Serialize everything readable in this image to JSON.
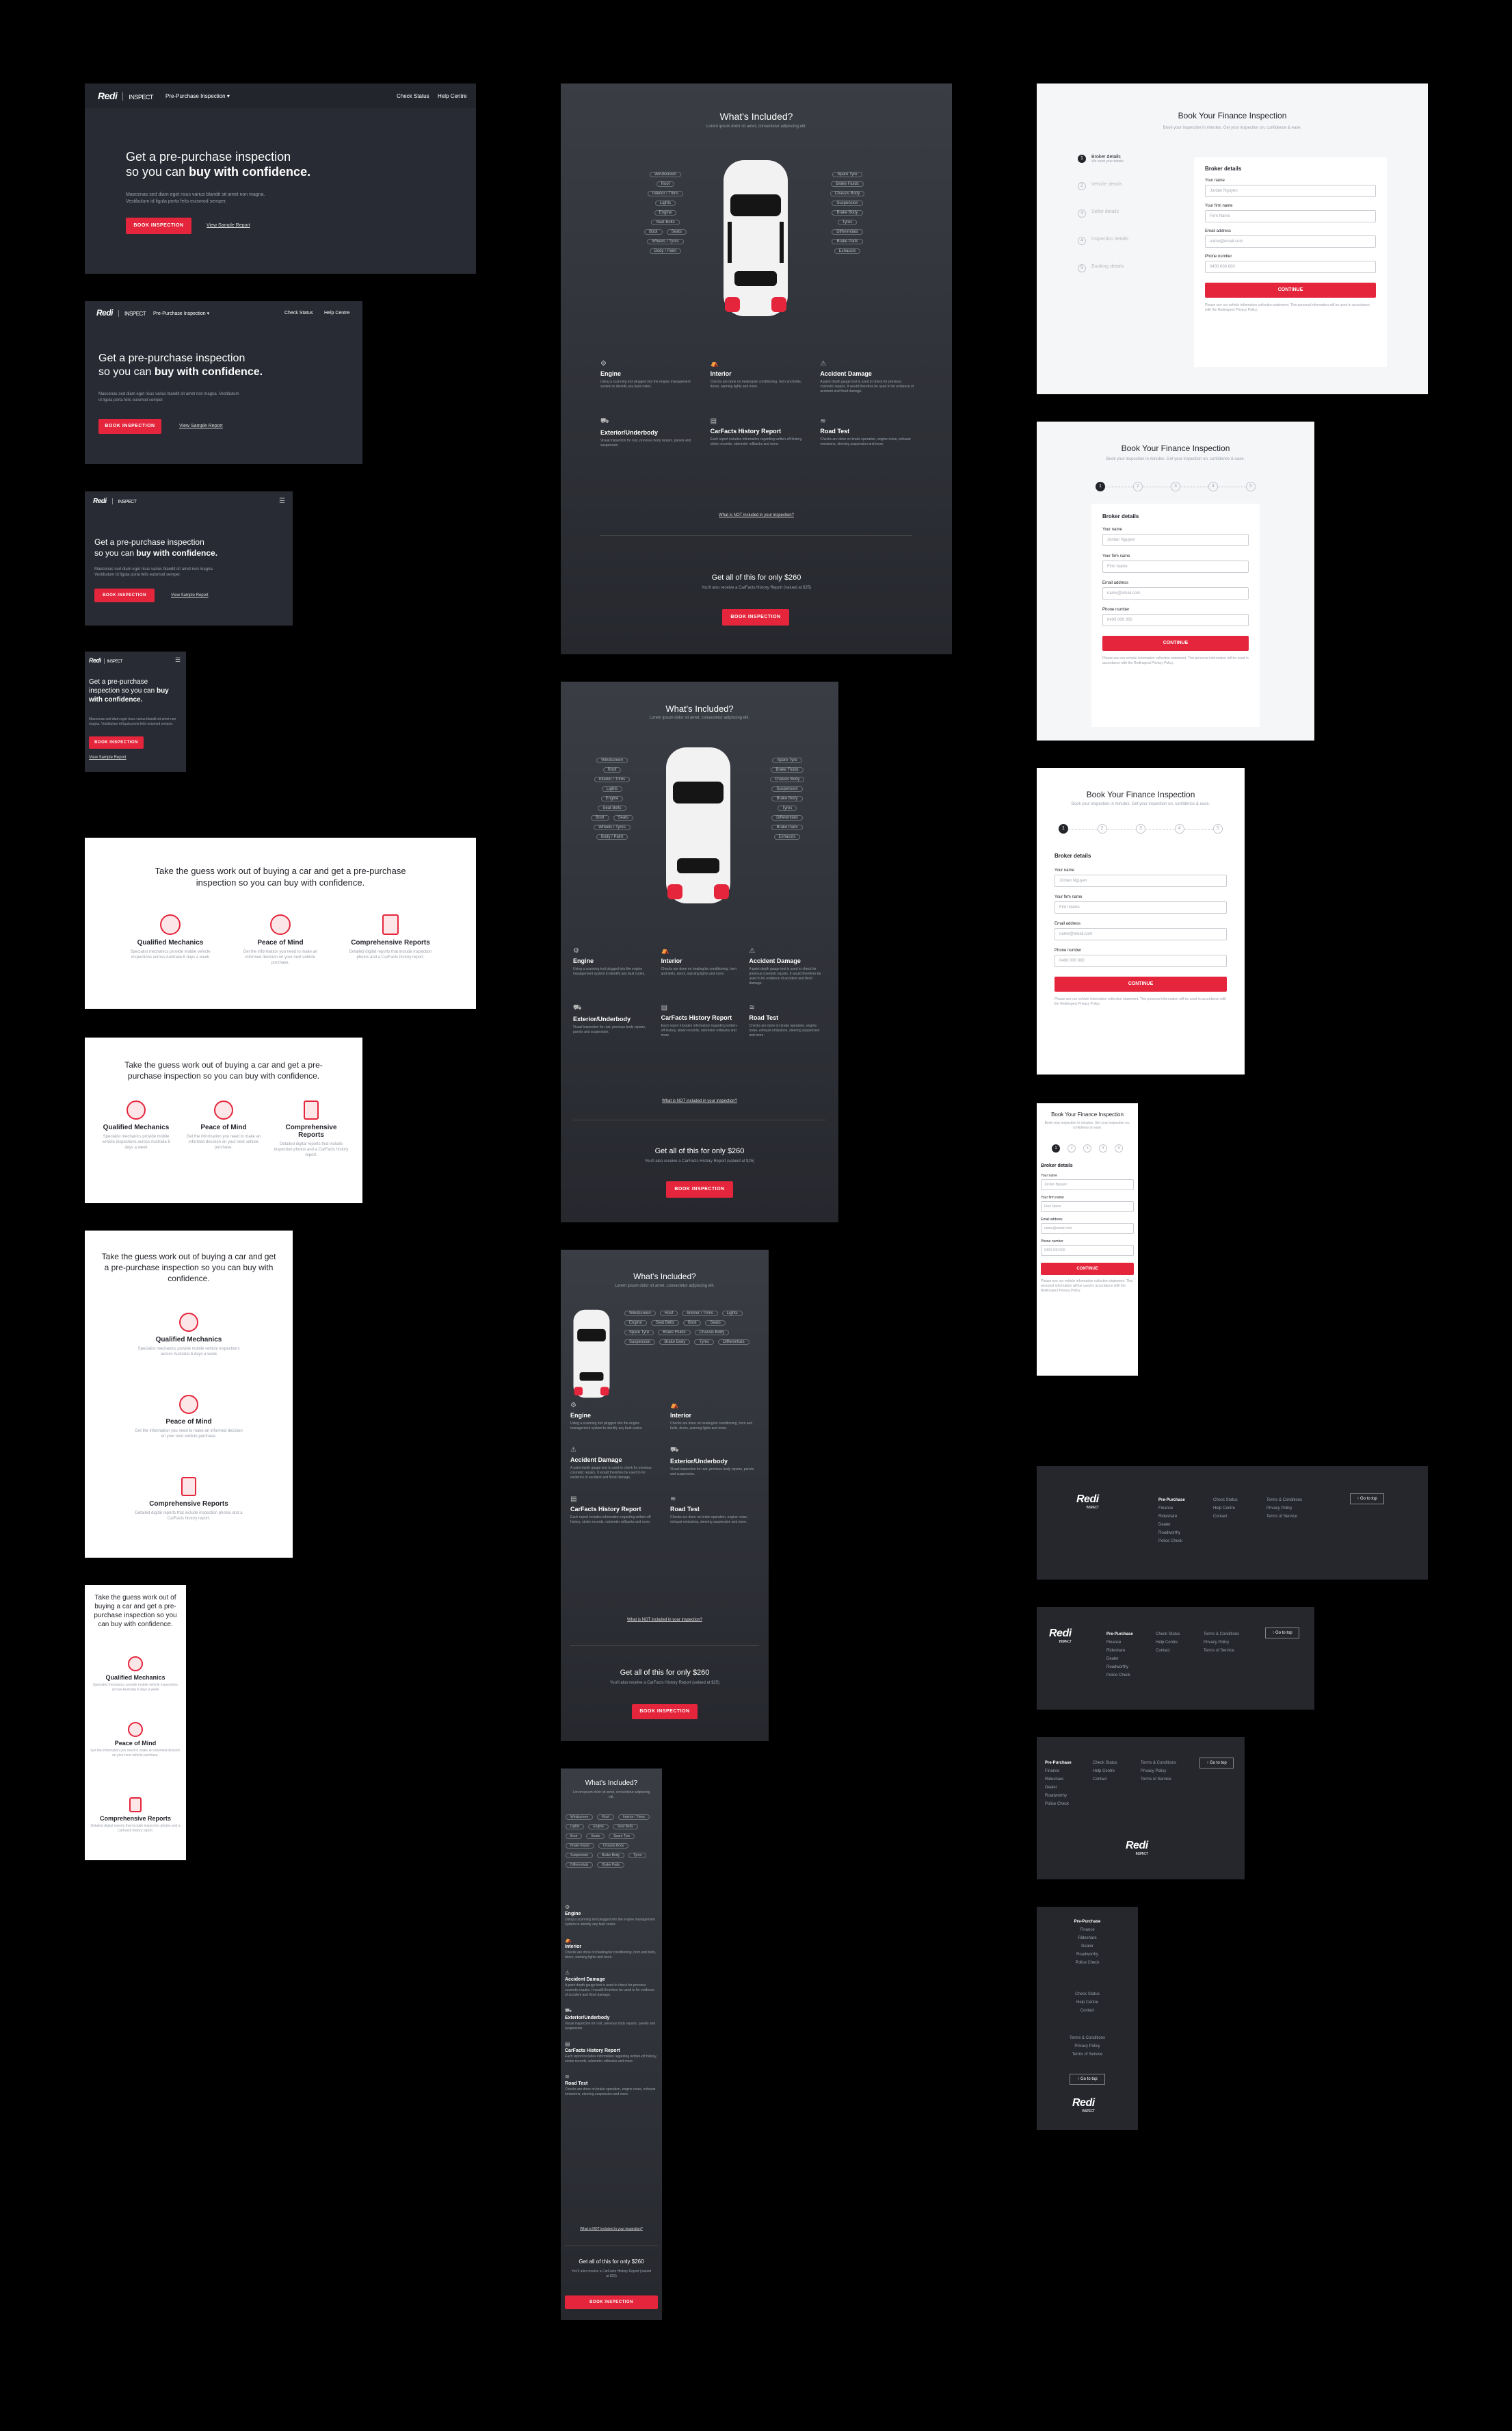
{
  "brand": {
    "logo": "Redi",
    "sub": "INSPECT"
  },
  "hero": {
    "nav_item": "Pre-Purchase Inspection",
    "nav_check": "Check Status",
    "nav_help": "Help Centre",
    "title_a": "Get a pre-purchase inspection",
    "title_b": "so you can ",
    "title_strong": "buy with confidence.",
    "body": "Maecenas sed diam eget risus varius blandit sit amet non magna. Vestibulum id ligula porta felis euismod semper.",
    "cta": "BOOK INSPECTION",
    "sample": "View Sample Report"
  },
  "benefits": {
    "heading": "Take the guess work out of buying a car and get a pre-purchase inspection so you can buy with confidence.",
    "items": [
      {
        "title": "Qualified Mechanics",
        "text": "Specialist mechanics provide mobile vehicle inspections across Australia 6 days a week"
      },
      {
        "title": "Peace of Mind",
        "text": "Get the information you need to make an informed decision on your next vehicle purchase."
      },
      {
        "title": "Comprehensive Reports",
        "text": "Detailed digital reports that include inspection photos and a CarFacts history report."
      }
    ]
  },
  "included": {
    "title": "What's Included?",
    "subtitle": "Lorem ipsum dolor sit amet, consectetur adipiscing elit.",
    "left_pills": [
      "Windscreen",
      "Roof",
      "Interior / Trims",
      "Lights",
      "Engine",
      "Seat Belts",
      "Boot",
      "Seats",
      "Wheels / Tyres",
      "Body / Paint"
    ],
    "right_pills": [
      "Spare Tyre",
      "Brake Fluids",
      "Chassis Body",
      "Suspension",
      "Brake Body",
      "Tyres",
      "Differentials",
      "Brake Pads",
      "Exhausts"
    ],
    "features": [
      {
        "title": "Engine",
        "text": "Using a scanning tool plugged into the engine management system to identify any fault codes."
      },
      {
        "title": "Interior",
        "text": "Checks are done on heating/air conditioning, horn and belts, doors, warning lights and more."
      },
      {
        "title": "Accident Damage",
        "text": "A paint depth gauge test is used to check for previous cosmetic repairs. It would therefore be used to for evidence of accident and flood damage."
      },
      {
        "title": "Exterior/Underbody",
        "text": "Visual inspection for rust, previous body repairs, panels and suspension."
      },
      {
        "title": "CarFacts History Report",
        "text": "Each report includes information regarding written-off history, stolen records, odometer rollbacks and more."
      },
      {
        "title": "Road Test",
        "text": "Checks are done on brake operation, engine noise, exhaust emissions, steering suspension and more."
      }
    ],
    "not_included": "What is NOT included in your inspection?",
    "price": "Get all of this for only $260",
    "price_note": "You'll also receive a CarFacts History Report (valued at $25)",
    "cta": "BOOK INSPECTION"
  },
  "booking": {
    "title": "Book Your Finance Inspection",
    "subtitle": "Book your inspection in minutes. Get your inspection on, confidence & ease.",
    "steps": [
      "Broker details",
      "Vehicle details",
      "Seller details",
      "Inspection details",
      "Booking details"
    ],
    "step_notes": [
      "We need your details",
      "",
      "",
      "",
      ""
    ],
    "panel_title": "Broker details",
    "fields": [
      {
        "label": "Your name",
        "placeholder": "Jordan Nguyen"
      },
      {
        "label": "Your firm name",
        "placeholder": "Firm Name"
      },
      {
        "label": "Email address",
        "placeholder": "name@email.com"
      },
      {
        "label": "Phone number",
        "placeholder": "0400 000 000"
      }
    ],
    "cta": "CONTINUE",
    "legal": "Please see our vehicle information collection statement. This personal information will be used in accordance with the Redinspect Privacy Policy."
  },
  "footer": {
    "col1": [
      "Pre-Purchase",
      "Finance",
      "Rideshare",
      "Dealer",
      "Roadworthy",
      "Police Check"
    ],
    "col2": [
      "Check Status",
      "Help Centre",
      "Contact"
    ],
    "col3": [
      "Terms & Conditions",
      "Privacy Policy",
      "Terms of Service"
    ],
    "top": "Go to top"
  }
}
